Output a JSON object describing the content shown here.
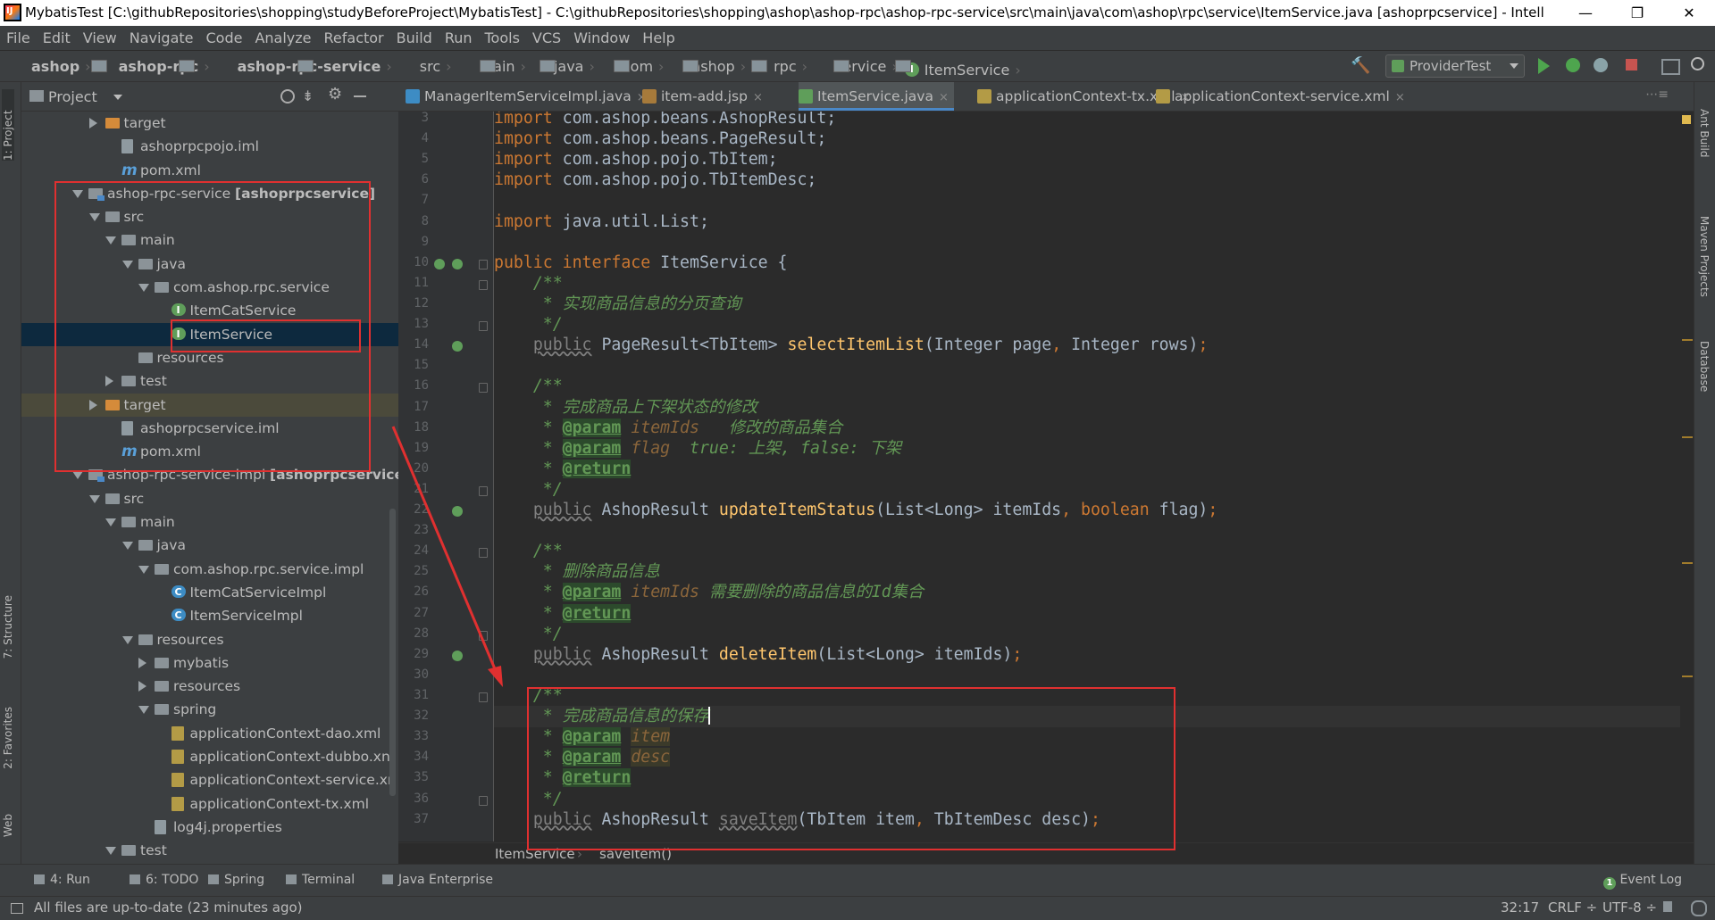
{
  "window": {
    "title": "MybatisTest [C:\\githubRepositories\\shopping\\studyBeforeProject\\MybatisTest] - C:\\githubRepositories\\shopping\\ashop\\ashop-rpc\\ashop-rpc-service\\src\\main\\java\\com\\ashop\\rpc\\service\\ItemService.java [ashoprpcservice] - IntelliJ I...",
    "minimize": "—",
    "maximize": "❐",
    "close": "✕"
  },
  "menu": [
    "File",
    "Edit",
    "View",
    "Navigate",
    "Code",
    "Analyze",
    "Refactor",
    "Build",
    "Run",
    "Tools",
    "VCS",
    "Window",
    "Help"
  ],
  "navbar": {
    "crumbs": [
      "ashop",
      "ashop-rpc",
      "ashop-rpc-service",
      "src",
      "main",
      "java",
      "com",
      "ashop",
      "rpc",
      "service",
      "ItemService"
    ],
    "run_config": "ProviderTest"
  },
  "left_tabs": {
    "project": "1: Project",
    "structure": "7: Structure",
    "favorites": "2: Favorites",
    "web": "Web"
  },
  "right_tabs": {
    "ant": "Ant Build",
    "maven": "Maven Projects",
    "database": "Database"
  },
  "project_panel": {
    "title": "Project",
    "tree": [
      {
        "label": "target",
        "indent": 0,
        "type": "ofolder",
        "arrow": "r"
      },
      {
        "label": "ashoprpcpojo.iml",
        "indent": 1,
        "type": "file",
        "arrow": ""
      },
      {
        "label": "pom.xml",
        "indent": 1,
        "type": "m",
        "arrow": ""
      },
      {
        "label": "ashop-rpc-service",
        "suffix": "[ashoprpcservice]",
        "indent": -1,
        "type": "module",
        "arrow": "d"
      },
      {
        "label": "src",
        "indent": 0,
        "type": "folder",
        "arrow": "d"
      },
      {
        "label": "main",
        "indent": 1,
        "type": "folder",
        "arrow": "d"
      },
      {
        "label": "java",
        "indent": 2,
        "type": "folder",
        "arrow": "d"
      },
      {
        "label": "com.ashop.rpc.service",
        "indent": 3,
        "type": "folder",
        "arrow": "d"
      },
      {
        "label": "ItemCatService",
        "indent": 4,
        "type": "ib",
        "arrow": ""
      },
      {
        "label": "ItemService",
        "indent": 4,
        "type": "ib",
        "arrow": "",
        "selected": true
      },
      {
        "label": "resources",
        "indent": 2,
        "type": "folder",
        "arrow": ""
      },
      {
        "label": "test",
        "indent": 1,
        "type": "folder",
        "arrow": "r"
      },
      {
        "label": "target",
        "indent": 0,
        "type": "ofolder",
        "arrow": "r",
        "highlight": true
      },
      {
        "label": "ashoprpcservice.iml",
        "indent": 1,
        "type": "file",
        "arrow": ""
      },
      {
        "label": "pom.xml",
        "indent": 1,
        "type": "m",
        "arrow": ""
      },
      {
        "label": "ashop-rpc-service-impl",
        "suffix": "[ashoprpcserviceimp",
        "indent": -1,
        "type": "module",
        "arrow": "d"
      },
      {
        "label": "src",
        "indent": 0,
        "type": "folder",
        "arrow": "d"
      },
      {
        "label": "main",
        "indent": 1,
        "type": "folder",
        "arrow": "d"
      },
      {
        "label": "java",
        "indent": 2,
        "type": "folder",
        "arrow": "d"
      },
      {
        "label": "com.ashop.rpc.service.impl",
        "indent": 3,
        "type": "folder",
        "arrow": "d"
      },
      {
        "label": "ItemCatServiceImpl",
        "indent": 4,
        "type": "cb",
        "arrow": ""
      },
      {
        "label": "ItemServiceImpl",
        "indent": 4,
        "type": "cb",
        "arrow": ""
      },
      {
        "label": "resources",
        "indent": 2,
        "type": "folder",
        "arrow": "d"
      },
      {
        "label": "mybatis",
        "indent": 3,
        "type": "folder",
        "arrow": "r"
      },
      {
        "label": "resources",
        "indent": 3,
        "type": "folder",
        "arrow": "r"
      },
      {
        "label": "spring",
        "indent": 3,
        "type": "folder",
        "arrow": "d"
      },
      {
        "label": "applicationContext-dao.xml",
        "indent": 4,
        "type": "xml",
        "arrow": ""
      },
      {
        "label": "applicationContext-dubbo.xn",
        "indent": 4,
        "type": "xml",
        "arrow": ""
      },
      {
        "label": "applicationContext-service.xr",
        "indent": 4,
        "type": "xml",
        "arrow": ""
      },
      {
        "label": "applicationContext-tx.xml",
        "indent": 4,
        "type": "xml",
        "arrow": ""
      },
      {
        "label": "log4j.properties",
        "indent": 3,
        "type": "file",
        "arrow": ""
      },
      {
        "label": "test",
        "indent": 1,
        "type": "folder",
        "arrow": "d"
      }
    ]
  },
  "tabs": [
    {
      "label": "ManagerItemServiceImpl.java",
      "icon": "#3d8cc4"
    },
    {
      "label": "item-add.jsp",
      "icon": "#a67a3b"
    },
    {
      "label": "ItemService.java",
      "icon": "#5f9e5a",
      "active": true
    },
    {
      "label": "applicationContext-tx.xml",
      "icon": "#b39b46"
    },
    {
      "label": "applicationContext-service.xml",
      "icon": "#b39b46"
    }
  ],
  "tab_close": "×",
  "editor": {
    "lines": [
      {
        "n": "3",
        "html": "<span class='kw'>import</span> com.ashop.beans.AshopResult;"
      },
      {
        "n": "4",
        "html": "<span class='kw'>import</span> com.ashop.beans.PageResult;"
      },
      {
        "n": "5",
        "html": "<span class='kw'>import</span> com.ashop.pojo.TbItem;"
      },
      {
        "n": "6",
        "html": "<span class='kw'>import</span> com.ashop.pojo.TbItemDesc;"
      },
      {
        "n": "7",
        "html": ""
      },
      {
        "n": "8",
        "html": "<span class='kw'>import</span> java.util.List;"
      },
      {
        "n": "9",
        "html": ""
      },
      {
        "n": "10",
        "html": "<span class='kw'>public interface</span> ItemService {"
      },
      {
        "n": "11",
        "html": "    <span class='cm'>/**</span>"
      },
      {
        "n": "12",
        "html": "<span class='cm'>     * 实现商品信息的分页查询</span>"
      },
      {
        "n": "13",
        "html": "<span class='cm'>     */</span>"
      },
      {
        "n": "14",
        "html": "    <span class='dim uw'>public</span> PageResult&lt;TbItem&gt; <span class='fn'>selectItemList</span>(Integer page<span class='kw'>,</span> Integer rows)<span class='kw'>;</span>"
      },
      {
        "n": "15",
        "html": ""
      },
      {
        "n": "16",
        "html": "    <span class='cm'>/**</span>"
      },
      {
        "n": "17",
        "html": "<span class='cm'>     * 完成商品上下架状态的修改</span>"
      },
      {
        "n": "18",
        "html": "<span class='cm'>     * </span><span class='tg'>@param</span> <span class='pv'>itemIds</span>   <span class='cm'>修改的商品集合</span>"
      },
      {
        "n": "19",
        "html": "<span class='cm'>     * </span><span class='tg'>@param</span> <span class='pv'>flag</span>  <span class='cm'>true: 上架, false: 下架</span>"
      },
      {
        "n": "20",
        "html": "<span class='cm'>     * </span><span class='tg'>@return</span>"
      },
      {
        "n": "21",
        "html": "<span class='cm'>     */</span>"
      },
      {
        "n": "22",
        "html": "    <span class='dim uw'>public</span> AshopResult <span class='fn'>updateItemStatus</span>(List&lt;Long&gt; itemIds<span class='kw'>,</span> <span class='kw'>boolean</span> flag)<span class='kw'>;</span>"
      },
      {
        "n": "23",
        "html": ""
      },
      {
        "n": "24",
        "html": "    <span class='cm'>/**</span>"
      },
      {
        "n": "25",
        "html": "<span class='cm'>     * 删除商品信息</span>"
      },
      {
        "n": "26",
        "html": "<span class='cm'>     * </span><span class='tg'>@param</span> <span class='pv'>itemIds</span> <span class='cm'>需要删除的商品信息的Id集合</span>"
      },
      {
        "n": "27",
        "html": "<span class='cm'>     * </span><span class='tg'>@return</span>"
      },
      {
        "n": "28",
        "html": "<span class='cm'>     */</span>"
      },
      {
        "n": "29",
        "html": "    <span class='dim uw'>public</span> AshopResult <span class='fn'>deleteItem</span>(List&lt;Long&gt; itemIds)<span class='kw'>;</span>"
      },
      {
        "n": "30",
        "html": ""
      },
      {
        "n": "31",
        "html": "    <span class='cm'>/**</span>"
      },
      {
        "n": "32",
        "html": "<span class='cm'>     * 完成商品信息的保存</span>",
        "cur": true
      },
      {
        "n": "33",
        "html": "<span class='cm'>     * </span><span class='tg'>@param</span> <span class='pv' style='background:#3b3a2a'>item</span>"
      },
      {
        "n": "34",
        "html": "<span class='cm'>     * </span><span class='tg'>@param</span> <span class='pv' style='background:#3b3a2a'>desc</span>"
      },
      {
        "n": "35",
        "html": "<span class='cm'>     * </span><span class='tg'>@return</span>"
      },
      {
        "n": "36",
        "html": "<span class='cm'>     */</span>"
      },
      {
        "n": "37",
        "html": "    <span class='dim uw'>public</span> AshopResult <span class='uw dim'>saveItem</span>(TbItem item<span class='kw'>,</span> TbItemDesc desc)<span class='kw'>;</span>"
      }
    ],
    "first_line_partial": "import com.ashop.beans.AshopResult;"
  },
  "editor_breadcrumb": {
    "class": "ItemService",
    "method": "saveItem()"
  },
  "bottom_tools": [
    {
      "label": "4: Run"
    },
    {
      "label": "6: TODO"
    },
    {
      "label": "Spring"
    },
    {
      "label": "Terminal"
    },
    {
      "label": "Java Enterprise"
    }
  ],
  "event_log": "Event Log",
  "status": {
    "message": "All files are up-to-date (23 minutes ago)",
    "position": "32:17",
    "line_sep": "CRLF",
    "encoding": "UTF-8"
  }
}
